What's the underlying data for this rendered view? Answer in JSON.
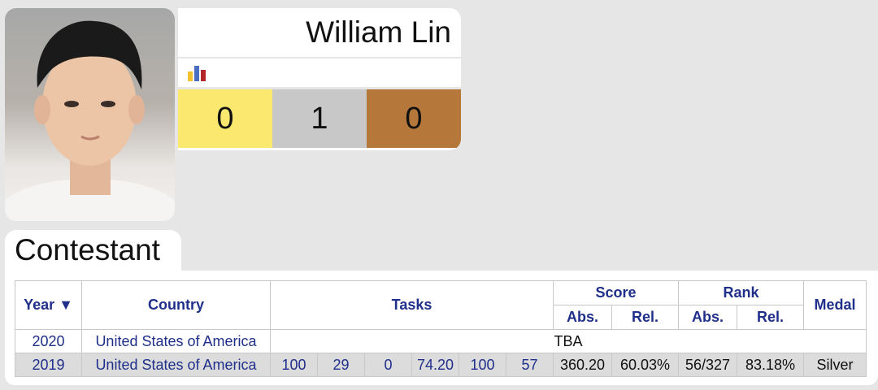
{
  "profile": {
    "name": "William Lin",
    "medals": {
      "gold": "0",
      "silver": "1",
      "bronze": "0"
    }
  },
  "section": {
    "title": "Contestant"
  },
  "table": {
    "headers": {
      "year": "Year ▼",
      "country": "Country",
      "tasks": "Tasks",
      "score": "Score",
      "rank": "Rank",
      "medal": "Medal",
      "abs": "Abs.",
      "rel": "Rel."
    },
    "rows": [
      {
        "year": "2020",
        "country": "United States of America",
        "tba": "TBA"
      },
      {
        "year": "2019",
        "country": "United States of America",
        "tasks": [
          "100",
          "29",
          "0",
          "74.20",
          "100",
          "57"
        ],
        "score_abs": "360.20",
        "score_rel": "60.03%",
        "rank_abs": "56/327",
        "rank_rel": "83.18%",
        "medal": "Silver"
      }
    ]
  },
  "icons": {
    "chart": "bar-chart-icon"
  },
  "colors": {
    "gold": "#fbe96f",
    "silver": "#c8c8c8",
    "bronze": "#b5773a",
    "link": "#1f2f8a"
  }
}
